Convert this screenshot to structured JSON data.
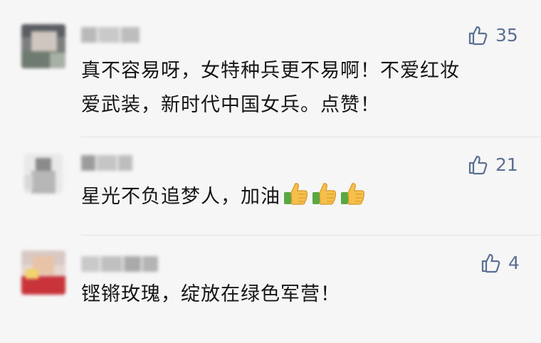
{
  "comments": [
    {
      "text_lines": [
        "真不容易呀，女特种兵更不易啊！不爱红妆",
        "爱武装，新时代中国女兵。点赞！"
      ],
      "likes": "35",
      "icon": "thumbs-up-outline-icon"
    },
    {
      "text_lines": [
        "星光不负追梦人，加油"
      ],
      "likes": "21",
      "icon": "thumbs-up-outline-icon",
      "emojis": [
        "thumbs-up-emoji",
        "thumbs-up-emoji",
        "thumbs-up-emoji"
      ]
    },
    {
      "text_lines": [
        "铿锵玫瑰，绽放在绿色军营！"
      ],
      "likes": "4",
      "icon": "thumbs-up-outline-icon"
    }
  ],
  "colors": {
    "like_color": "#5b6f93",
    "text_color": "#151515",
    "background": "#f6f6f6"
  }
}
